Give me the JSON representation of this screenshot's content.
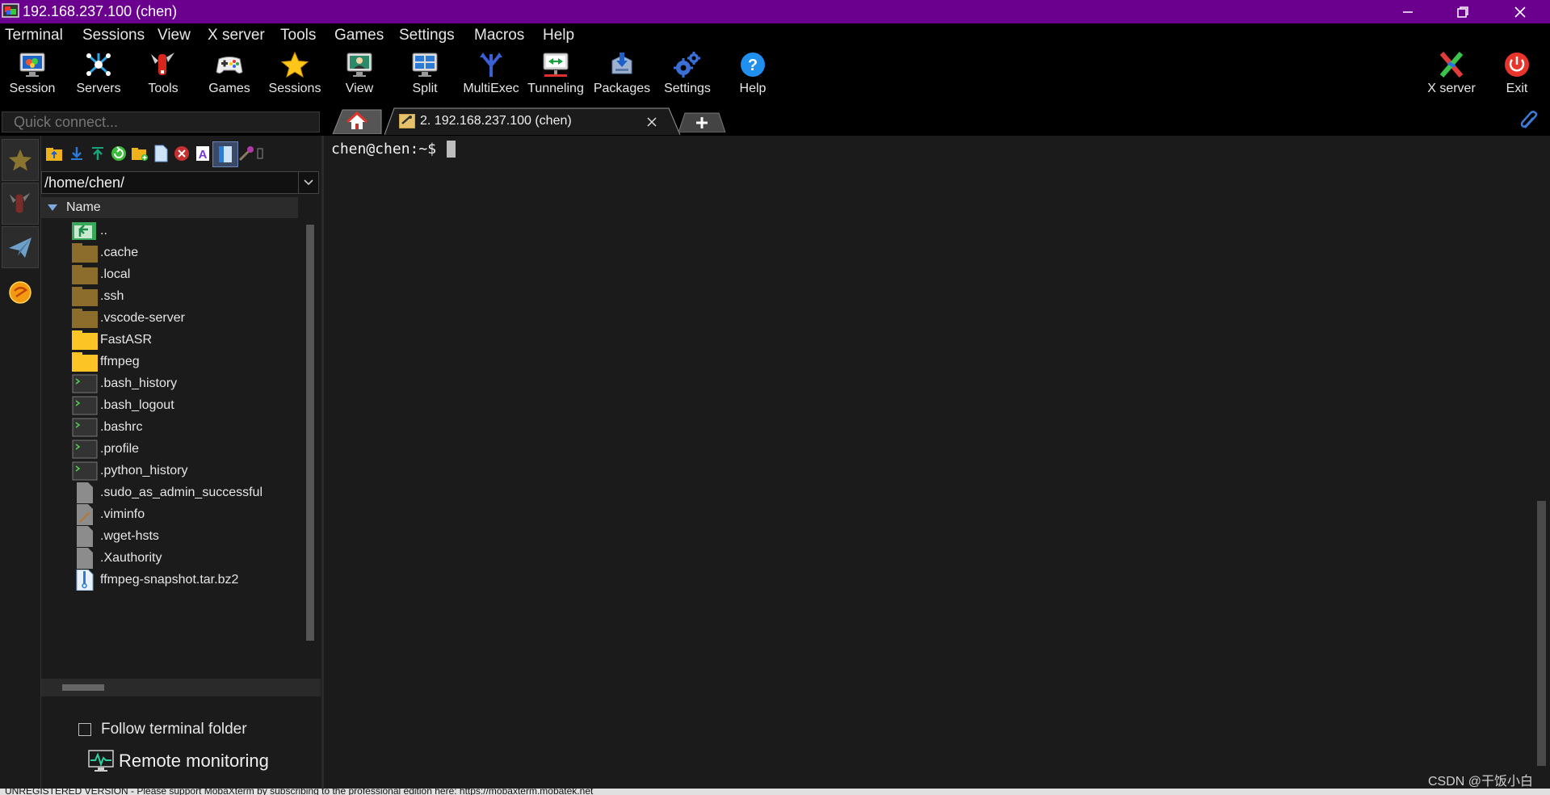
{
  "window": {
    "title": "192.168.237.100 (chen)",
    "title_bar_color": "#6b008f"
  },
  "menu": {
    "items": [
      "Terminal",
      "Sessions",
      "View",
      "X server",
      "Tools",
      "Games",
      "Settings",
      "Macros",
      "Help"
    ]
  },
  "toolbar": {
    "tools": [
      {
        "label": "Session",
        "icon": "session-monitor-icon"
      },
      {
        "label": "Servers",
        "icon": "servers-icon"
      },
      {
        "label": "Tools",
        "icon": "tools-knife-icon"
      },
      {
        "label": "Games",
        "icon": "gamepad-icon"
      },
      {
        "label": "Sessions",
        "icon": "star-icon"
      },
      {
        "label": "View",
        "icon": "view-monitor-icon"
      },
      {
        "label": "Split",
        "icon": "split-icon"
      },
      {
        "label": "MultiExec",
        "icon": "multiexec-icon"
      },
      {
        "label": "Tunneling",
        "icon": "tunneling-icon"
      },
      {
        "label": "Packages",
        "icon": "packages-icon"
      },
      {
        "label": "Settings",
        "icon": "gears-icon"
      },
      {
        "label": "Help",
        "icon": "help-icon"
      }
    ],
    "right_tools": [
      {
        "label": "X server",
        "icon": "x-server-icon"
      },
      {
        "label": "Exit",
        "icon": "power-icon"
      }
    ]
  },
  "quick_connect": {
    "placeholder": "Quick connect..."
  },
  "tabs": {
    "session_tab": "2. 192.168.237.100 (chen)"
  },
  "sftp": {
    "path": "/home/chen/",
    "column_name": "Name",
    "files": [
      {
        "name": "..",
        "type": "parent"
      },
      {
        "name": ".cache",
        "type": "folder-dark"
      },
      {
        "name": ".local",
        "type": "folder-dark"
      },
      {
        "name": ".ssh",
        "type": "folder-dark"
      },
      {
        "name": ".vscode-server",
        "type": "folder-dark"
      },
      {
        "name": "FastASR",
        "type": "folder"
      },
      {
        "name": "ffmpeg",
        "type": "folder"
      },
      {
        "name": ".bash_history",
        "type": "terminal-file"
      },
      {
        "name": ".bash_logout",
        "type": "terminal-file"
      },
      {
        "name": ".bashrc",
        "type": "terminal-file"
      },
      {
        "name": ".profile",
        "type": "terminal-file"
      },
      {
        "name": ".python_history",
        "type": "terminal-file"
      },
      {
        "name": ".sudo_as_admin_successful",
        "type": "file"
      },
      {
        "name": ".viminfo",
        "type": "file-edit"
      },
      {
        "name": ".wget-hsts",
        "type": "file"
      },
      {
        "name": ".Xauthority",
        "type": "file"
      },
      {
        "name": "ffmpeg-snapshot.tar.bz2",
        "type": "archive"
      }
    ],
    "follow_label": "Follow terminal folder",
    "remote_label": "Remote monitoring"
  },
  "terminal": {
    "prompt": "chen@chen:~$ "
  },
  "watermark": "CSDN @干饭小白",
  "status": {
    "text": "UNREGISTERED VERSION  -  Please support MobaXterm by subscribing to the professional edition here:  https://mobaxterm.mobatek.net"
  }
}
